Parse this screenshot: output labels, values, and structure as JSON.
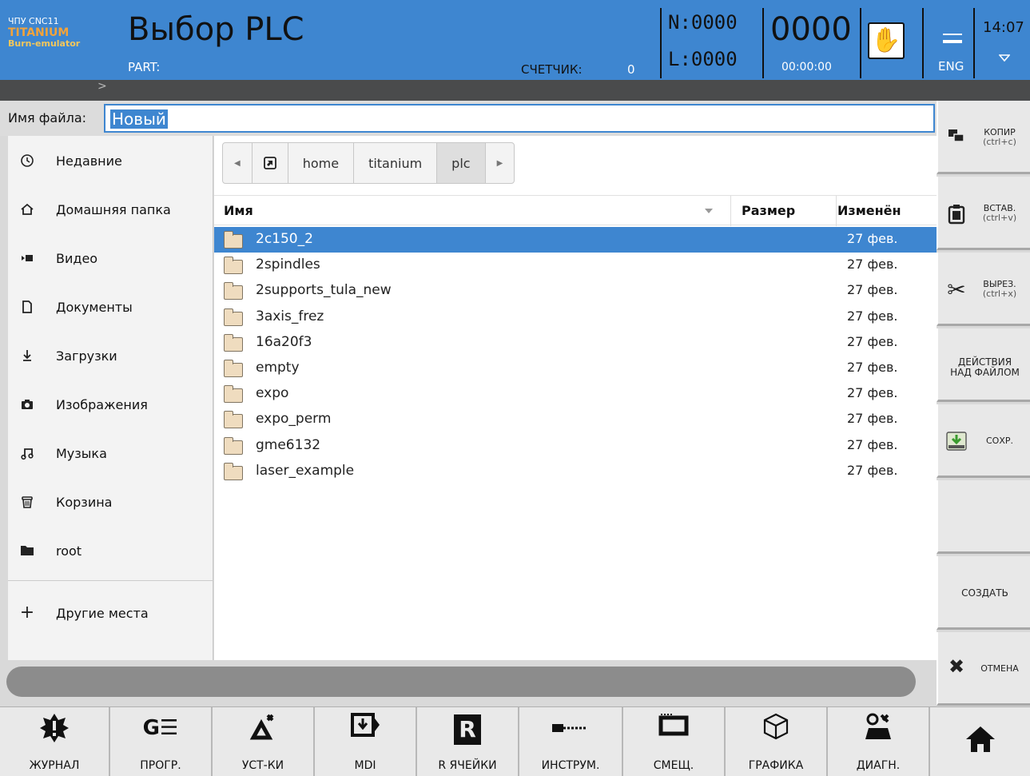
{
  "header": {
    "brand_line1": "ЧПУ CNC11",
    "brand_line2": "TITANIUM",
    "brand_line3": "Burn-emulator",
    "title": "Выбор PLC",
    "part_label": "PART:",
    "counter_label": "СЧЕТЧИК:",
    "counter_value": "0",
    "n_value": "N:0000",
    "l_value": "L:0000",
    "big_value": "0000",
    "timer": "00:00:00",
    "lang": "ENG",
    "clock": "14:07",
    "strip_arrow": ">"
  },
  "filename": {
    "label": "Имя файла:",
    "value": "Новый"
  },
  "places": [
    {
      "label": "Недавние",
      "icon": "clock-icon"
    },
    {
      "label": "Домашняя папка",
      "icon": "home-icon"
    },
    {
      "label": "Видео",
      "icon": "video-icon"
    },
    {
      "label": "Документы",
      "icon": "document-icon"
    },
    {
      "label": "Загрузки",
      "icon": "download-icon"
    },
    {
      "label": "Изображения",
      "icon": "camera-icon"
    },
    {
      "label": "Музыка",
      "icon": "music-icon"
    },
    {
      "label": "Корзина",
      "icon": "trash-icon"
    },
    {
      "label": "root",
      "icon": "folder-icon"
    }
  ],
  "other_places": "Другие места",
  "path": [
    "home",
    "titanium",
    "plc"
  ],
  "columns": {
    "name": "Имя",
    "size": "Размер",
    "modified": "Изменён"
  },
  "files": [
    {
      "name": "2c150_2",
      "date": "27 фев."
    },
    {
      "name": "2spindles",
      "date": "27 фев."
    },
    {
      "name": "2supports_tula_new",
      "date": "27 фев."
    },
    {
      "name": "3axis_frez",
      "date": "27 фев."
    },
    {
      "name": "16a20f3",
      "date": "27 фев."
    },
    {
      "name": "empty",
      "date": "27 фев."
    },
    {
      "name": "expo",
      "date": "27 фев."
    },
    {
      "name": "expo_perm",
      "date": "27 фев."
    },
    {
      "name": "gme6132",
      "date": "27 фев."
    },
    {
      "name": "laser_example",
      "date": "27 фев."
    }
  ],
  "softkeys": {
    "copy": "КОПИР",
    "copy_sub": "(ctrl+c)",
    "paste": "ВСТАВ.",
    "paste_sub": "(ctrl+v)",
    "cut": "ВЫРЕЗ.",
    "cut_sub": "(ctrl+x)",
    "actions_line1": "ДЕЙСТВИЯ",
    "actions_line2": "НАД ФАЙЛОМ",
    "save": "СОХР.",
    "create": "СОЗДАТЬ",
    "cancel": "ОТМЕНА"
  },
  "bottom_nav": [
    {
      "label": "ЖУРНАЛ",
      "icon": "alert-icon"
    },
    {
      "label": "ПРОГР.",
      "icon": "program-icon"
    },
    {
      "label": "УСТ-КИ",
      "icon": "settings-icon"
    },
    {
      "label": "MDI",
      "icon": "mdi-icon"
    },
    {
      "label": "R ЯЧЕЙКИ",
      "icon": "r-cells-icon"
    },
    {
      "label": "ИНСТРУМ.",
      "icon": "tool-icon"
    },
    {
      "label": "СМЕЩ.",
      "icon": "offset-icon"
    },
    {
      "label": "ГРАФИКА",
      "icon": "graphics-icon"
    },
    {
      "label": "ДИАГН.",
      "icon": "diagnostics-icon"
    }
  ],
  "colors": {
    "accent": "#3e86d0",
    "brand_orange": "#f3a33a"
  }
}
